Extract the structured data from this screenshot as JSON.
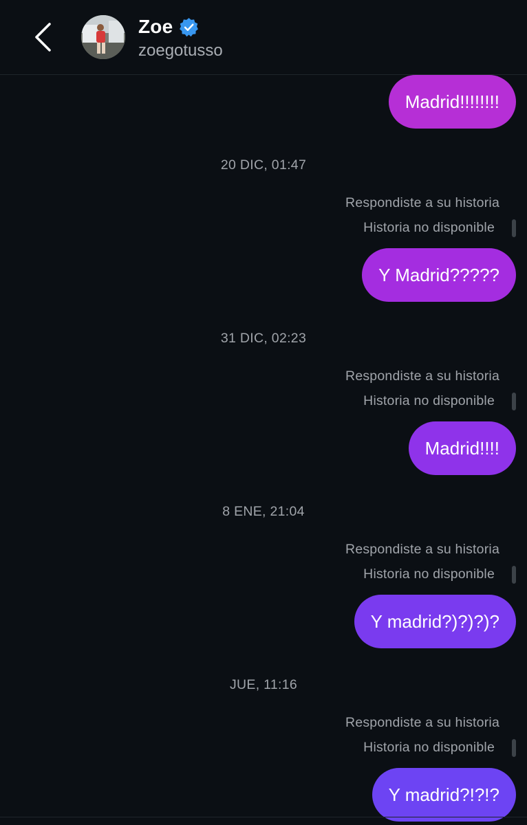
{
  "header": {
    "back_icon": "chevron-left-icon",
    "name": "Zoe",
    "handle": "zoegotusso",
    "verified_icon": "verified-badge-icon",
    "verified_color": "#3897f0"
  },
  "messages": [
    {
      "type": "sent",
      "text": "Madrid!!!!!!!!",
      "color": "#b62fd6"
    },
    {
      "type": "timestamp",
      "text": "20 DIC, 01:47"
    },
    {
      "type": "story_reply",
      "label": "Respondiste a su historia",
      "story": "Historia no disponible"
    },
    {
      "type": "sent",
      "text": "Y Madrid?????",
      "color": "#a42de0"
    },
    {
      "type": "timestamp",
      "text": "31 DIC, 02:23"
    },
    {
      "type": "story_reply",
      "label": "Respondiste a su historia",
      "story": "Historia no disponible"
    },
    {
      "type": "sent",
      "text": "Madrid!!!!",
      "color": "#8f33ea"
    },
    {
      "type": "timestamp",
      "text": "8 ENE, 21:04"
    },
    {
      "type": "story_reply",
      "label": "Respondiste a su historia",
      "story": "Historia no disponible"
    },
    {
      "type": "sent",
      "text": "Y madrid?)?)?)?",
      "color": "#7a3bef"
    },
    {
      "type": "timestamp",
      "text": "JUE, 11:16"
    },
    {
      "type": "story_reply",
      "label": "Respondiste a su historia",
      "story": "Historia no disponible"
    },
    {
      "type": "sent",
      "text": "Y madrid?!?!?",
      "color": "#6d44f3"
    }
  ]
}
